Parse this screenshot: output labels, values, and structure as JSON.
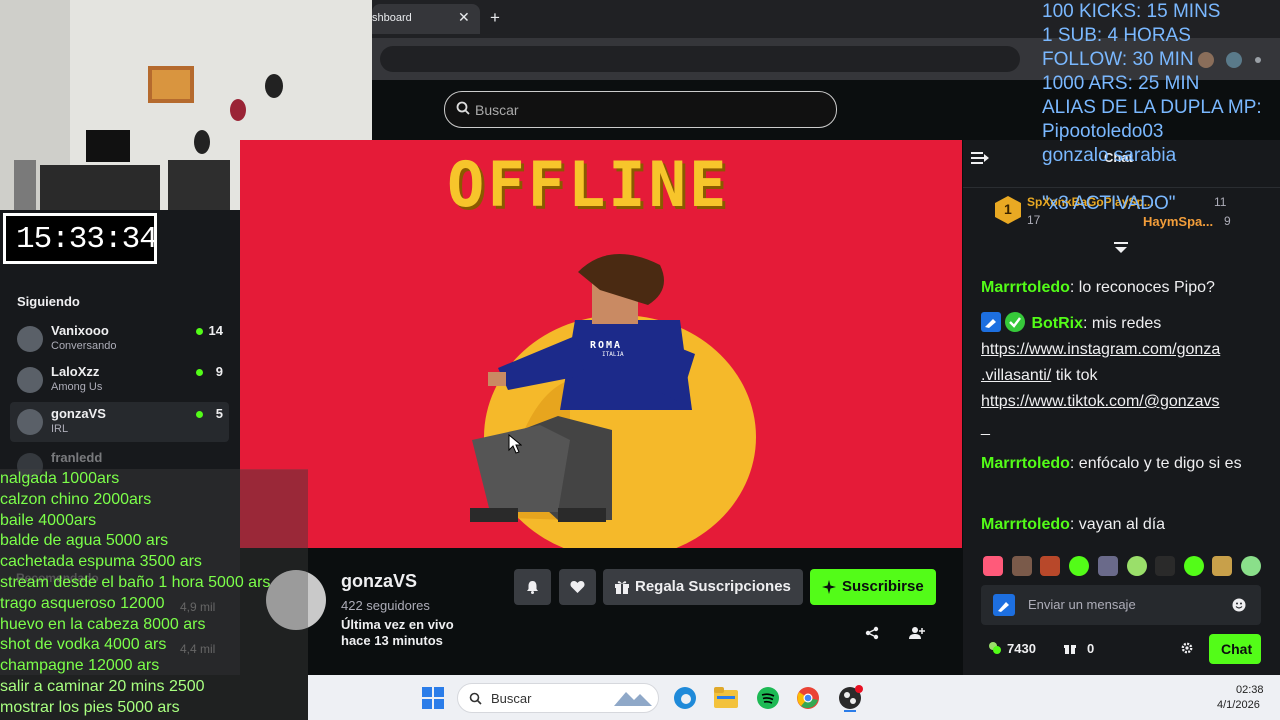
{
  "browser": {
    "tab_title": "shboard",
    "close_glyph": "✕",
    "newtab_glyph": "+"
  },
  "header": {
    "search_placeholder": "Buscar"
  },
  "clock": {
    "time": "15:33:34"
  },
  "sidebar": {
    "section_title": "Siguiendo",
    "following": [
      {
        "name": "Vanixooo",
        "category": "Conversando",
        "viewers": "14"
      },
      {
        "name": "LaloXzz",
        "category": "Among Us",
        "viewers": "9"
      },
      {
        "name": "gonzaVS",
        "category": "IRL",
        "viewers": "5"
      },
      {
        "name": "franledd",
        "category": "",
        "viewers": ""
      }
    ]
  },
  "player": {
    "status_text": "OFFLINE",
    "hoodie_text": "ROMA",
    "hoodie_subtext": "ITALIA"
  },
  "channel": {
    "name": "gonzaVS",
    "followers": "422 seguidores",
    "last_live_line1": "Última vez en vivo",
    "last_live_line2": "hace 13 minutos",
    "gift_label": "Regala Suscripciones",
    "subscribe_label": "Suscribirse"
  },
  "chat": {
    "title": "Chat",
    "pinned": [
      {
        "badge": "1",
        "name": "SpXonkBaGoPlaySp...",
        "count": "11"
      },
      {
        "name": "HaymSpa...",
        "count": "9"
      }
    ],
    "pinned_small": "17",
    "messages": [
      {
        "user": "Marrrtoledo",
        "text": ": lo reconoces Pipo?"
      },
      {
        "user": "BotRix",
        "text": ": mis redes"
      },
      {
        "user": "Marrrtoledo",
        "text": ": enfócalo y te digo si es"
      },
      {
        "user": "Marrrtoledo",
        "text": ": vayan al día"
      }
    ],
    "links": [
      "https://www.instagram.com/gonza",
      ".villasanti/",
      " tik tok",
      "https://www.tiktok.com/@gonzavs",
      "_"
    ],
    "input_placeholder": "Enviar un mensaje",
    "points": "7430",
    "gifts": "0",
    "send_label": "Chat"
  },
  "overlay_right": [
    "100 KICKS: 15 MINS",
    "1 SUB: 4 HORAS",
    "FOLLOW: 30 MIN",
    "1000 ARS: 25 MIN",
    "ALIAS DE LA DUPLA MP:",
    "Pipootoledo03",
    "gonzalo sarabia",
    "",
    "\"x3 ACTIVADO\""
  ],
  "overlay_left": [
    "nalgada 1000ars",
    "calzon chino 2000ars",
    "baile 4000ars",
    "balde de agua 5000 ars",
    "cachetada espuma 3500 ars",
    "stream desde el baño 1 hora 5000 ars",
    "trago asqueroso 12000",
    "huevo en la cabeza 8000 ars",
    "shot de vodka 4000 ars",
    "champagne 12000 ars",
    "salir a caminar 20 mins 2500",
    "mostrar los pies 5000 ars"
  ],
  "overlay_bg_texts": {
    "recommended": "Recomendado",
    "viewers_a": "4,9 mil",
    "viewers_b": "4,4 mil"
  },
  "taskbar": {
    "search_placeholder": "Buscar",
    "time": "02:38",
    "date": "4/1/2026"
  },
  "colors": {
    "brand_green": "#53fc18",
    "player_red": "#e51b38",
    "offline_yellow": "#f7c52b",
    "overlay_blue": "#7ab8ff",
    "overlay_green": "#7cff4a"
  }
}
